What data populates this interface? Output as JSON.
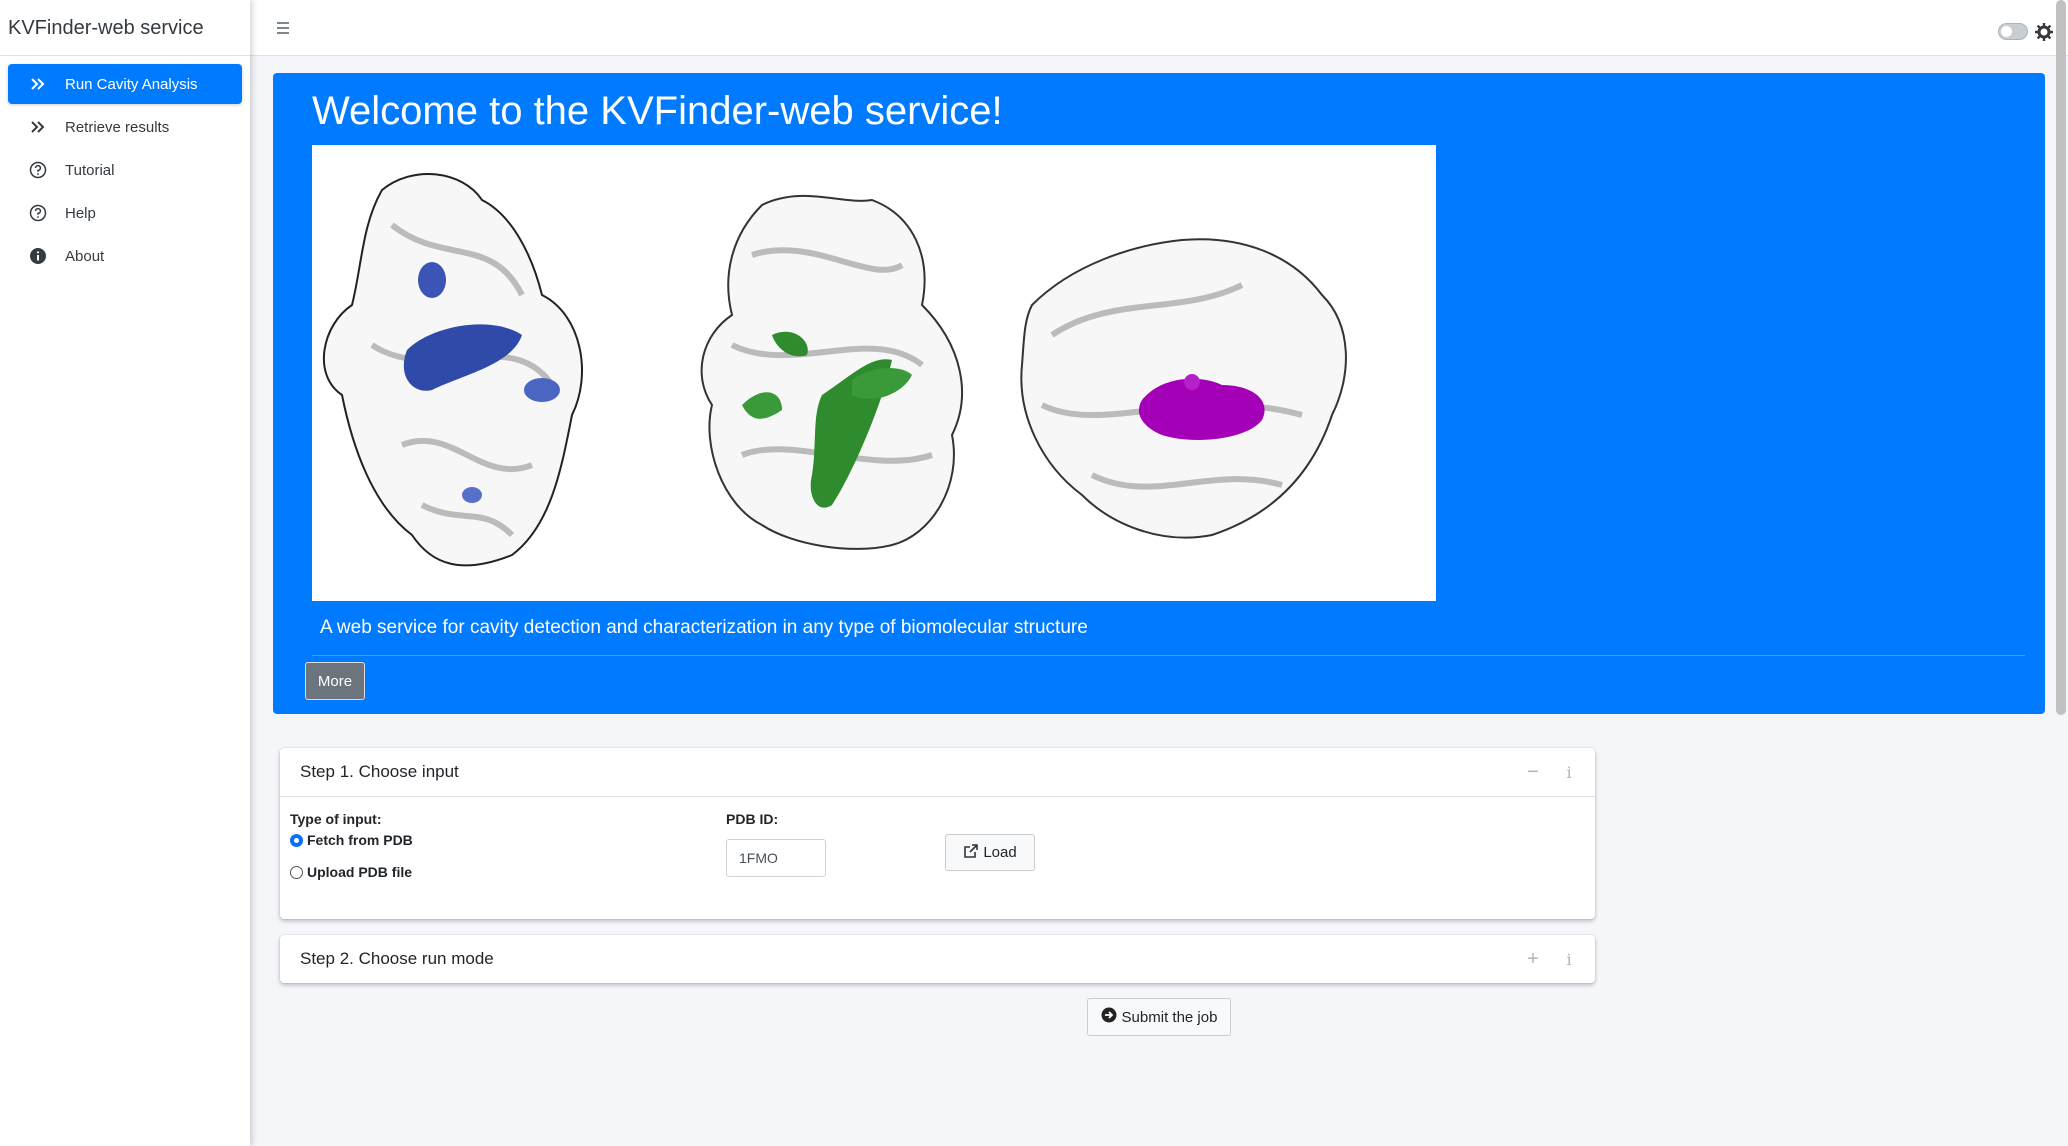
{
  "app": {
    "title": "KVFinder-web service"
  },
  "sidebar": {
    "items": [
      {
        "label": "Run Cavity Analysis",
        "icon": "double-chevron-right-icon",
        "active": true
      },
      {
        "label": "Retrieve results",
        "icon": "double-chevron-right-icon",
        "active": false
      },
      {
        "label": "Tutorial",
        "icon": "question-circle-icon",
        "active": false
      },
      {
        "label": "Help",
        "icon": "question-circle-icon",
        "active": false
      },
      {
        "label": "About",
        "icon": "info-circle-icon",
        "active": false
      }
    ]
  },
  "jumbotron": {
    "title": "Welcome to the KVFinder-web service!",
    "lead": "A web service for cavity detection and characterization in any type of biomolecular structure",
    "more_label": "More",
    "cavity_colors": [
      "#2f4aa8",
      "#2e8b2e",
      "#a300b8"
    ]
  },
  "step1": {
    "title": "Step 1. Choose input",
    "type_label": "Type of input:",
    "options": [
      "Fetch from PDB",
      "Upload PDB file"
    ],
    "selected": "Fetch from PDB",
    "pdb_label": "PDB ID:",
    "pdb_value": "1FMO",
    "load_label": "Load"
  },
  "step2": {
    "title": "Step 2. Choose run mode"
  },
  "submit_label": "Submit the job",
  "colors": {
    "accent": "#007bff",
    "secondary": "#6c757d"
  }
}
